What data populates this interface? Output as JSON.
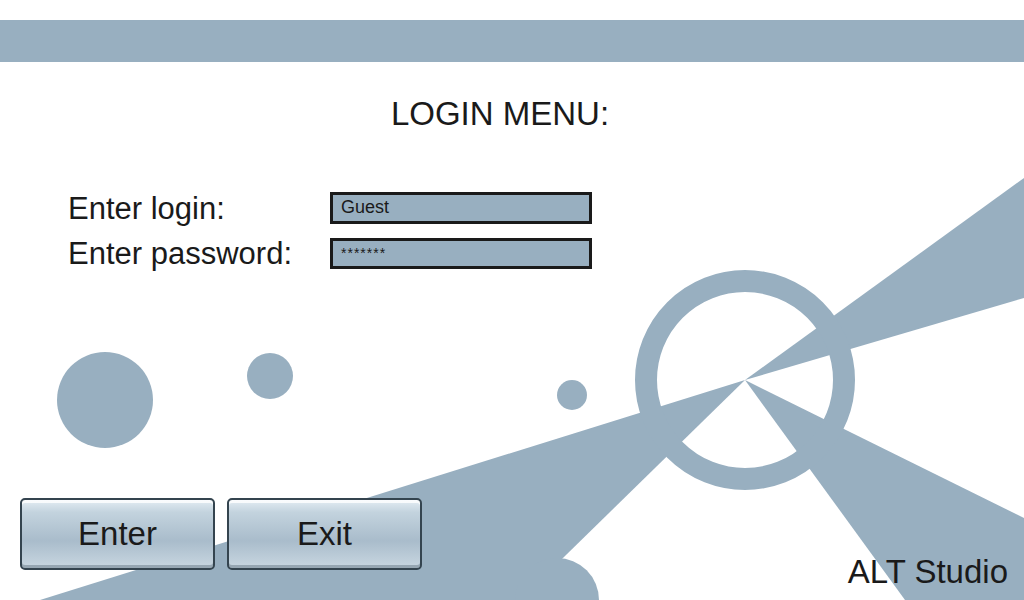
{
  "window": {
    "title": "LOGIN MENU:"
  },
  "fields": [
    {
      "label": "Enter login:",
      "value": "Guest",
      "kind": "text"
    },
    {
      "label": "Enter password:",
      "value": "*******",
      "kind": "password"
    }
  ],
  "buttons": [
    "Enter",
    "Exit"
  ],
  "brand": "ALT Studio"
}
